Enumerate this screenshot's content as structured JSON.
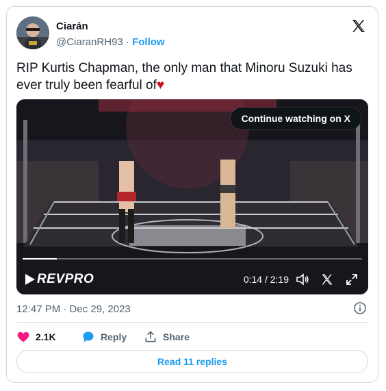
{
  "author": {
    "name": "Ciarán",
    "handle": "@CiaranRH93",
    "separator": "·",
    "follow_label": "Follow"
  },
  "tweet": {
    "text": "RIP Kurtis Chapman, the only man that Minoru Suzuki has ever truly been fearful of",
    "emoji": "♥"
  },
  "video": {
    "continue_label": "Continue watching on X",
    "time": "0:14 / 2:19",
    "progress": 0.1,
    "watermark": "REVPRO"
  },
  "meta": {
    "timestamp": "12:47 PM · Dec 29, 2023"
  },
  "actions": {
    "likes": "2.1K",
    "reply_label": "Reply",
    "share_label": "Share"
  },
  "read_replies_label": "Read 11 replies",
  "colors": {
    "accent": "#1d9bf0",
    "like": "#f91880",
    "text": "#0f1419",
    "muted": "#536471"
  }
}
